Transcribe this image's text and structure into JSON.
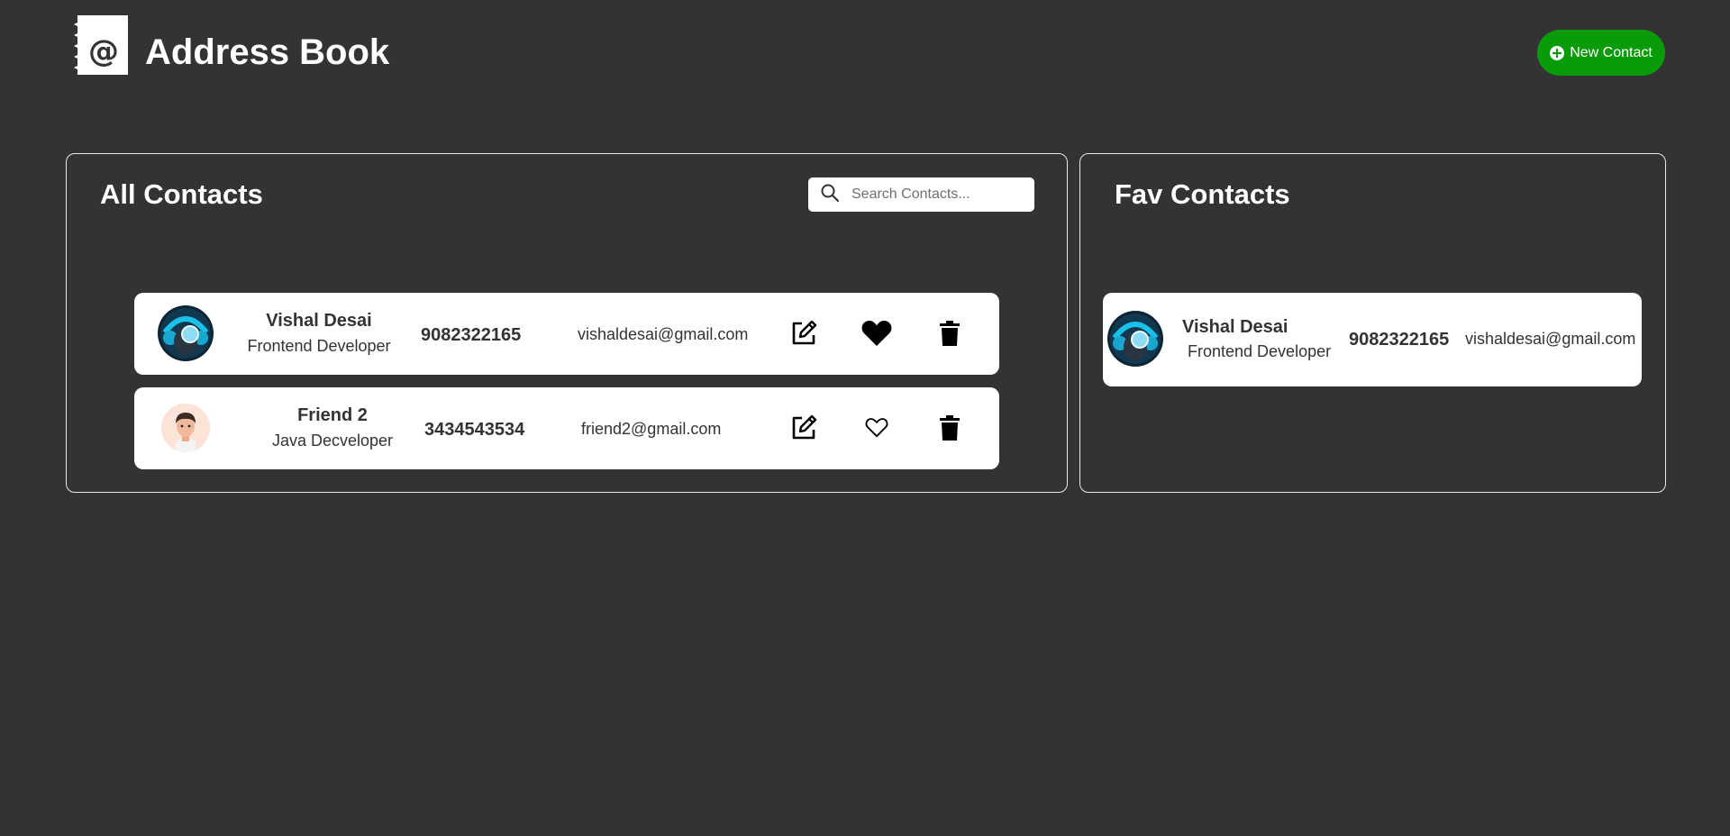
{
  "header": {
    "title": "Address Book",
    "new_contact_label": "New Contact"
  },
  "all_contacts": {
    "title": "All Contacts",
    "search_placeholder": "Search Contacts...",
    "contacts": [
      {
        "name": "Vishal Desai",
        "role": "Frontend Developer",
        "phone": "9082322165",
        "email": "vishaldesai@gmail.com",
        "favorite": true,
        "avatar": "avatar-headphones"
      },
      {
        "name": "Friend 2",
        "role": "Java Decveloper",
        "phone": "3434543534",
        "email": "friend2@gmail.com",
        "favorite": false,
        "avatar": "avatar-cartoon-man"
      }
    ]
  },
  "fav_contacts": {
    "title": "Fav Contacts",
    "contacts": [
      {
        "name": "Vishal Desai",
        "role": "Frontend Developer",
        "phone": "9082322165",
        "email": "vishaldesai@gmail.com",
        "avatar": "avatar-headphones"
      }
    ]
  },
  "colors": {
    "background": "#333333",
    "accent_green": "#0a9b0a",
    "card": "#ffffff",
    "text_dark": "#333333"
  }
}
